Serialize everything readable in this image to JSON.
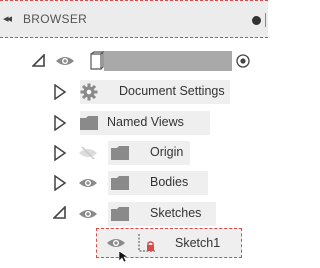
{
  "panel": {
    "title": "BROWSER",
    "collapse_glyph": "◂◂"
  },
  "root": {
    "has_radio": true
  },
  "items": [
    {
      "label": "Document Settings",
      "icon": "gear-icon"
    },
    {
      "label": "Named Views",
      "icon": "folder-icon"
    },
    {
      "label": "Origin",
      "icon": "folder-icon",
      "eye": "hidden"
    },
    {
      "label": "Bodies",
      "icon": "folder-icon",
      "eye": "visible"
    },
    {
      "label": "Sketches",
      "icon": "folder-icon",
      "eye": "visible",
      "expanded": true
    },
    {
      "label": "Sketch1",
      "icon": "sketch-icon",
      "eye": "visible",
      "selected": true
    }
  ],
  "colors": {
    "accent_dash": "#d94a4a",
    "icon_gray": "#8a8a8a"
  }
}
